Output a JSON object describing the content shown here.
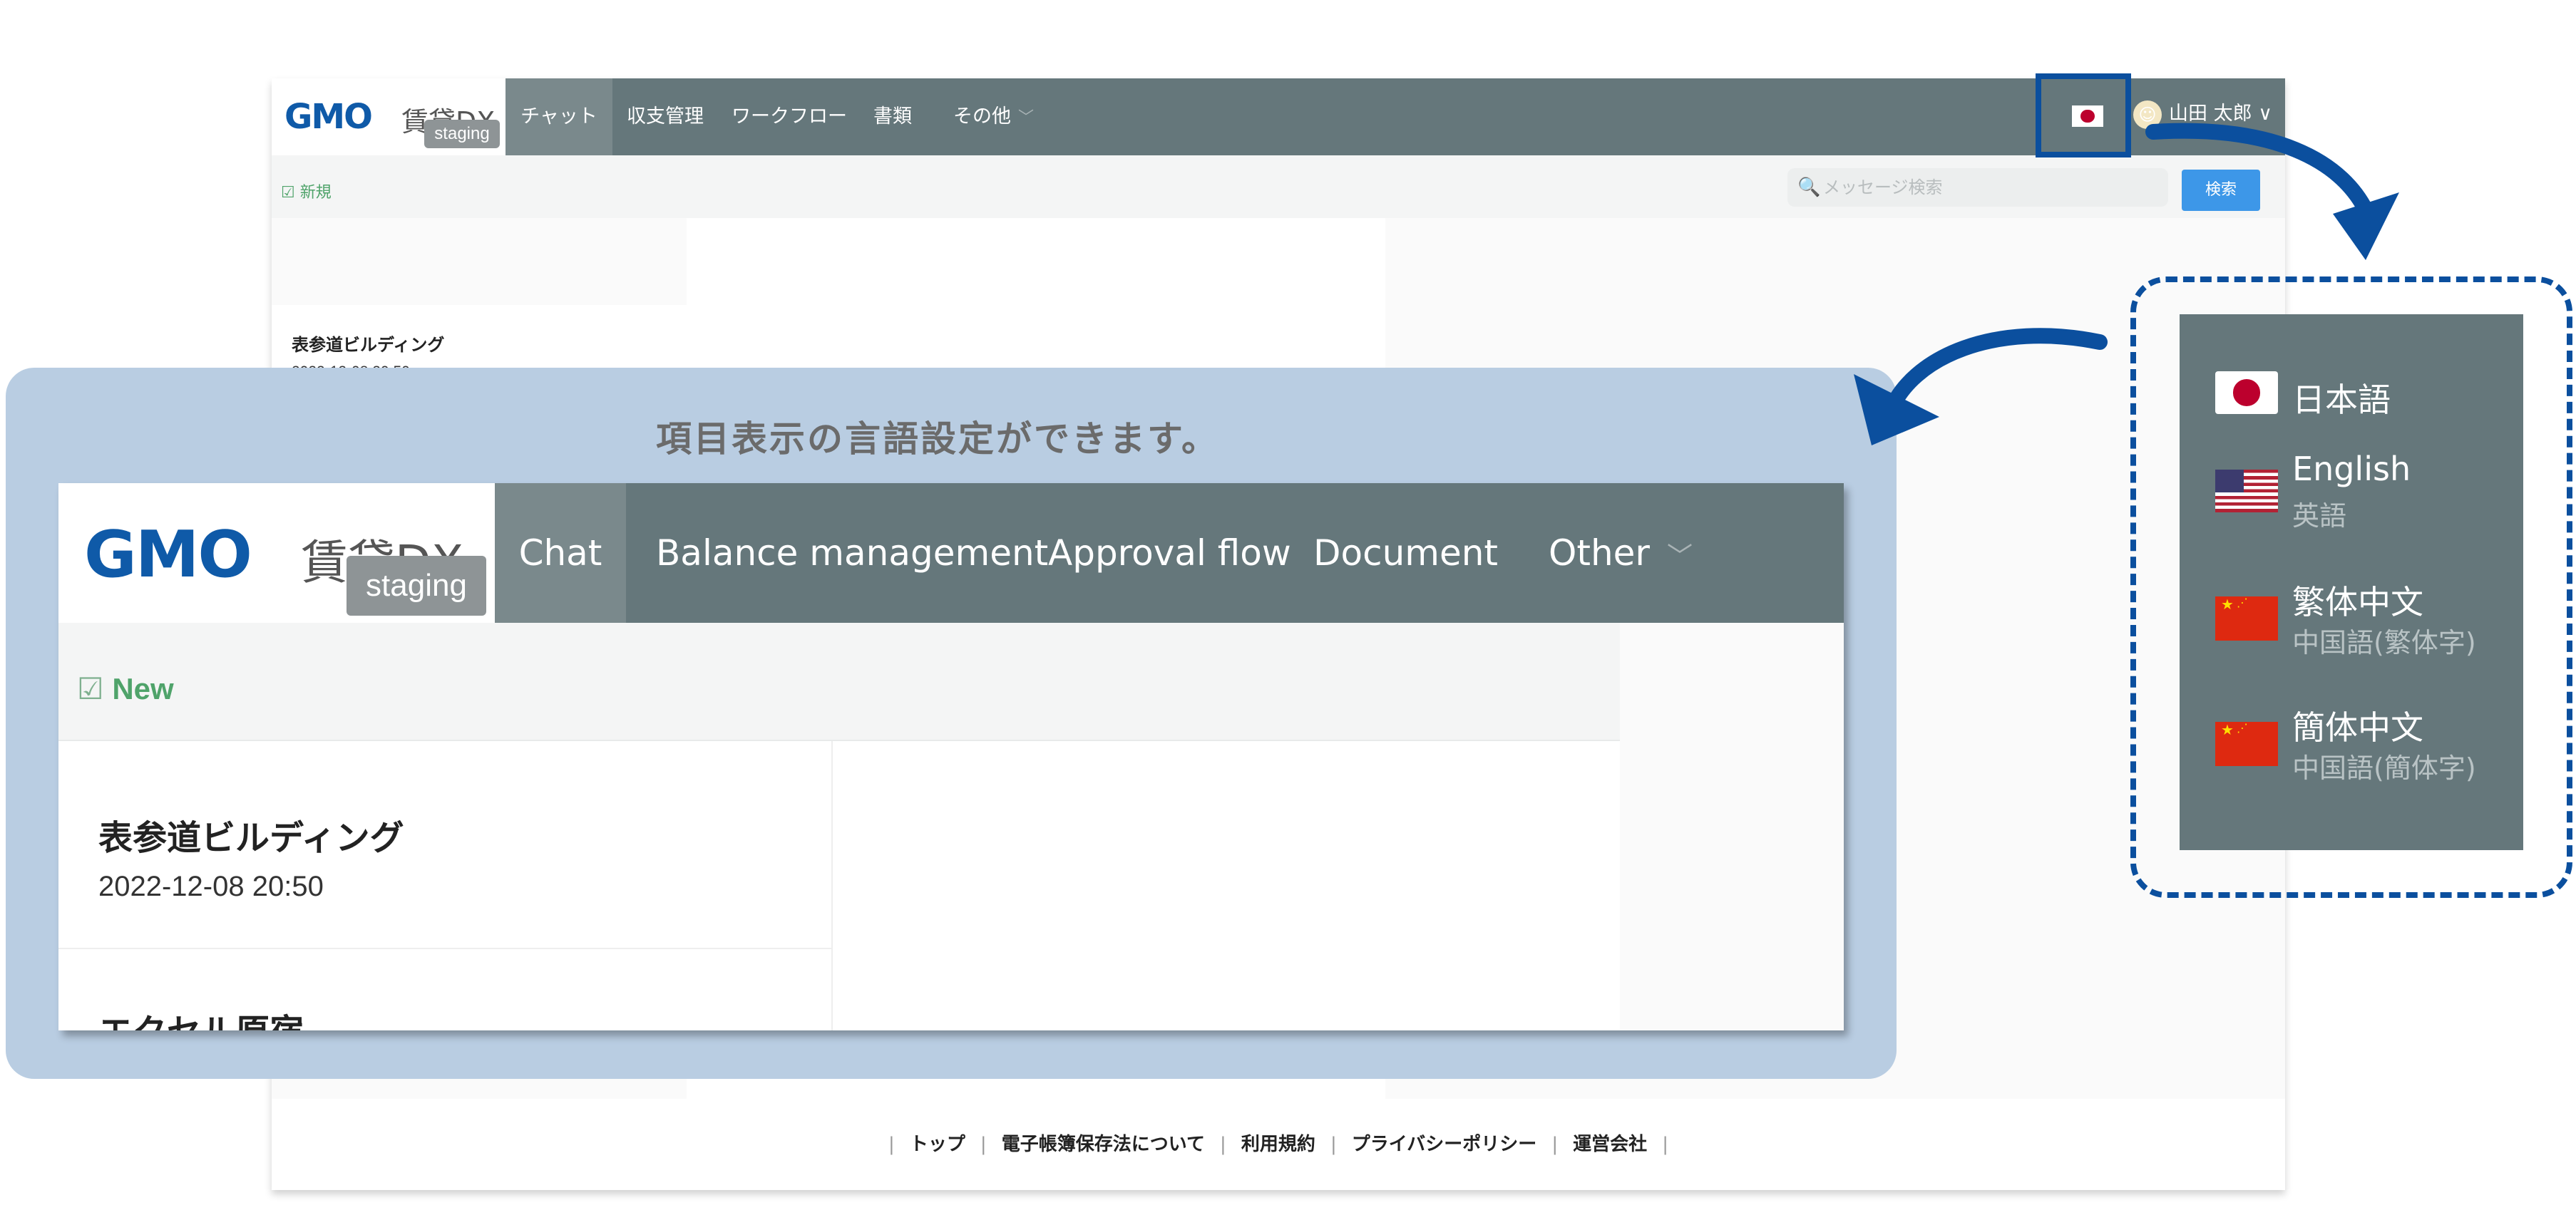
{
  "header": {
    "logo_gmo": "GMO",
    "logo_dx": "賃貸DX",
    "staging_badge": "staging",
    "nav_items": [
      "チャット",
      "収支管理",
      "ワークフロー",
      "書類",
      "その他"
    ],
    "user_name": "山田 太郎",
    "user_chevron": "∨"
  },
  "toolbar": {
    "new_label": "新規",
    "search_placeholder": "メッセージ検索",
    "search_button": "検索"
  },
  "list": {
    "items": [
      {
        "title": "表参道ビルディング",
        "date": "2022-12-08 20:50"
      }
    ]
  },
  "footer": {
    "links": [
      "トップ",
      "電子帳簿保存法について",
      "利用規約",
      "プライバシーポリシー",
      "運営会社"
    ],
    "separator": "|"
  },
  "callout": {
    "caption": "項目表示の言語設定ができます。",
    "nav_items": [
      "Chat",
      "Balance management",
      "Approval flow",
      "Document",
      "Other"
    ],
    "new_label": "New",
    "items": [
      {
        "title": "表参道ビルディング",
        "date": "2022-12-08 20:50"
      },
      {
        "title": "エクセル原宿"
      }
    ]
  },
  "language_menu": {
    "options": [
      {
        "name": "日本語",
        "sub": "",
        "flag": "japan-flag-icon"
      },
      {
        "name": "English",
        "sub": "英語",
        "flag": "us-flag-icon"
      },
      {
        "name": "繁体中文",
        "sub": "中国語(繁体字)",
        "flag": "china-flag-icon"
      },
      {
        "name": "簡体中文",
        "sub": "中国語(簡体字)",
        "flag": "china-flag-icon"
      }
    ]
  },
  "colors": {
    "nav_bg": "#65777b",
    "active_nav": "#7a898c",
    "accent_blue": "#0b4f9e",
    "brand_blue": "#0f5aa8",
    "callout_bg": "#b9cde2",
    "search_button": "#3d97e8",
    "new_green": "#4fa36a"
  }
}
